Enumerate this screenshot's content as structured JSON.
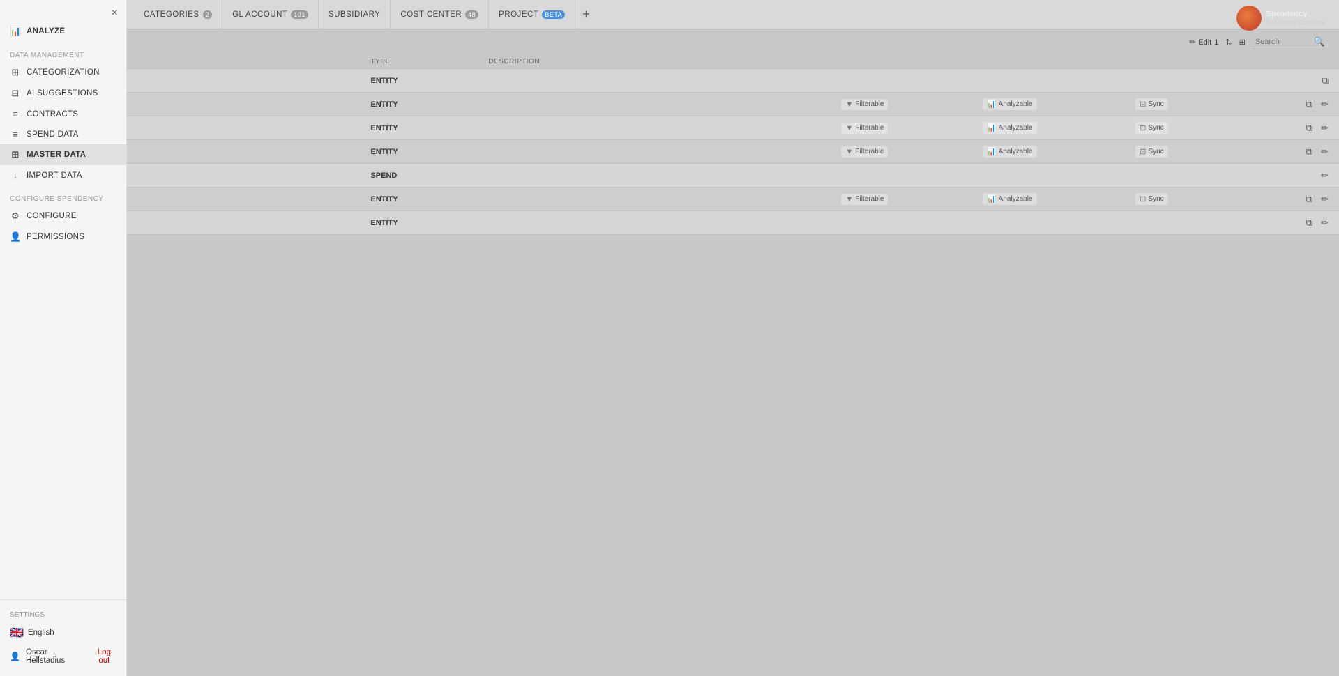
{
  "sidebar": {
    "close_btn": "×",
    "analyze_label": "ANALYZE",
    "data_management_label": "Data management",
    "items": [
      {
        "id": "categorization",
        "label": "CATEGORIZATION",
        "icon": "⊞"
      },
      {
        "id": "ai-suggestions",
        "label": "AI SUGGESTIONS",
        "icon": "⊟",
        "active": false
      },
      {
        "id": "contracts",
        "label": "CONTRACTS",
        "icon": "≡",
        "active": false
      },
      {
        "id": "spend-data",
        "label": "SPEND DATA",
        "icon": "≡"
      },
      {
        "id": "master-data",
        "label": "MASTER DATA",
        "icon": "⊞",
        "active": true
      },
      {
        "id": "import-data",
        "label": "IMPORT DATA",
        "icon": "↓"
      }
    ],
    "configure_spendency_label": "Configure Spendency",
    "config_items": [
      {
        "id": "configure",
        "label": "CONFIGURE",
        "icon": "⚙"
      },
      {
        "id": "permissions",
        "label": "PERMISSIONS",
        "icon": "👤"
      }
    ],
    "settings_label": "Settings",
    "language": "English",
    "user_name": "Oscar Hellstadius",
    "logout_label": "Log out"
  },
  "header": {
    "logo_alt": "Spendency"
  },
  "tabs": [
    {
      "id": "categories",
      "label": "CATEGORIES",
      "badge": "2",
      "badge_type": "normal"
    },
    {
      "id": "gl-account",
      "label": "GL ACCOUNT",
      "badge": "101",
      "badge_type": "normal"
    },
    {
      "id": "subsidiary",
      "label": "SUBSIDIARY",
      "badge": null
    },
    {
      "id": "cost-center",
      "label": "COST CENTER",
      "badge": "48",
      "badge_type": "normal"
    },
    {
      "id": "project",
      "label": "PROJECT",
      "badge": "BETA",
      "badge_type": "blue"
    }
  ],
  "add_tab_label": "+",
  "toolbar": {
    "edit_label": "Edit",
    "edit_count": "1",
    "sort_icon": "⇅",
    "filter_icon": "⊞",
    "search_placeholder": "Search"
  },
  "table": {
    "columns": [
      {
        "id": "name",
        "label": ""
      },
      {
        "id": "type",
        "label": "TYPE"
      },
      {
        "id": "description",
        "label": "DESCRIPTION"
      },
      {
        "id": "filterable",
        "label": ""
      },
      {
        "id": "analyzable",
        "label": ""
      },
      {
        "id": "sync",
        "label": ""
      },
      {
        "id": "actions",
        "label": ""
      }
    ],
    "rows": [
      {
        "name": "",
        "type": "ENTITY",
        "description": "",
        "filterable": null,
        "analyzable": null,
        "sync": null,
        "has_external": true,
        "has_edit": false
      },
      {
        "name": "",
        "type": "ENTITY",
        "description": "",
        "filterable": "Filterable",
        "analyzable": "Analyzable",
        "sync": "Sync",
        "has_external": true,
        "has_edit": true
      },
      {
        "name": "",
        "type": "ENTITY",
        "description": "",
        "filterable": "Filterable",
        "analyzable": "Analyzable",
        "sync": "Sync",
        "has_external": true,
        "has_edit": true
      },
      {
        "name": "",
        "type": "ENTITY",
        "description": "",
        "filterable": "Filterable",
        "analyzable": "Analyzable",
        "sync": "Sync",
        "has_external": true,
        "has_edit": true
      },
      {
        "name": "",
        "type": "SPEND",
        "description": "",
        "filterable": null,
        "analyzable": null,
        "sync": null,
        "has_external": false,
        "has_edit": true
      },
      {
        "name": "",
        "type": "ENTITY",
        "description": "",
        "filterable": "Filterable",
        "analyzable": "Analyzable",
        "sync": "Sync",
        "has_external": true,
        "has_edit": true
      },
      {
        "name": "",
        "type": "ENTITY",
        "description": "",
        "filterable": null,
        "analyzable": null,
        "sync": null,
        "has_external": true,
        "has_edit": true
      }
    ]
  }
}
